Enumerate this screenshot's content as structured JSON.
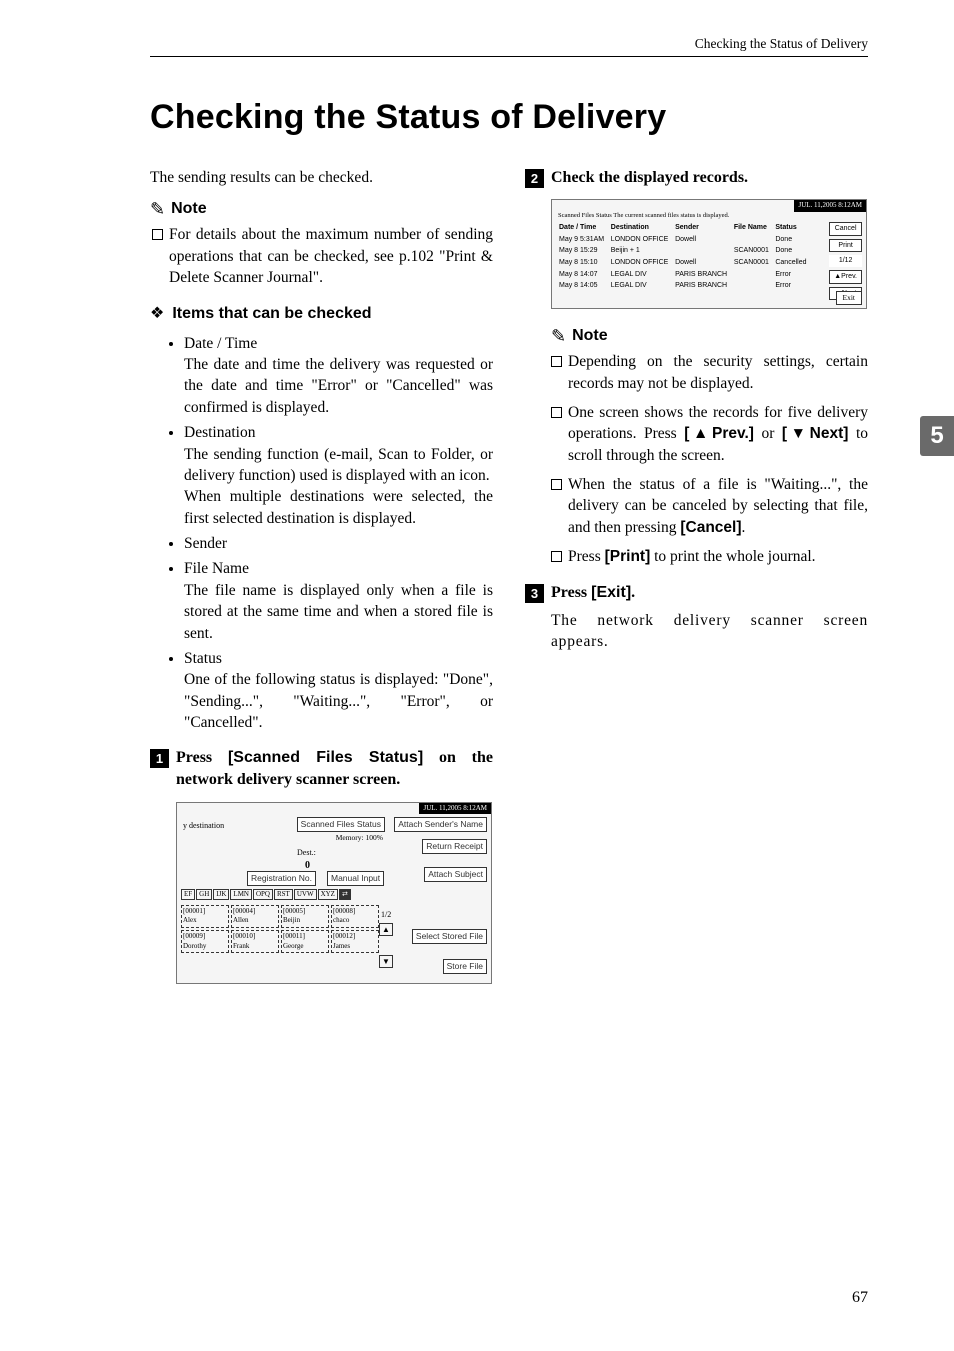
{
  "running_header": "Checking the Status of Delivery",
  "title": "Checking the Status of Delivery",
  "intro": "The sending results can be checked.",
  "note_label": "Note",
  "top_note": "For details about the maximum number of sending operations that can be checked, see p.102 \"Print & Delete Scanner Journal\".",
  "items_heading": "Items that can be checked",
  "items": [
    {
      "title": "Date / Time",
      "body": "The date and time the delivery was requested or the date and time \"Error\" or \"Cancelled\" was confirmed is displayed."
    },
    {
      "title": "Destination",
      "body": "The sending function (e-mail, Scan to Folder, or delivery function) used is displayed with an icon.",
      "body2": "When multiple destinations were selected, the first selected destination is displayed."
    },
    {
      "title": "Sender",
      "body": ""
    },
    {
      "title": "File Name",
      "body": "The file name is displayed only when a file is stored at the same time and when a stored file is sent."
    },
    {
      "title": "Status",
      "body": "One of the following status is displayed: \"Done\", \"Sending...\", \"Waiting...\", \"Error\", or \"Cancelled\"."
    }
  ],
  "steps": {
    "s1": {
      "pre": "Press ",
      "btn1": "[Scanned Files Status]",
      "post": " on the network delivery scanner screen."
    },
    "s2": "Check the displayed records.",
    "s3": {
      "pre": "Press ",
      "btn": "[Exit]",
      "post": "."
    }
  },
  "right_notes": [
    "Depending on the security settings, certain records may not be displayed.",
    {
      "pre": "One screen shows the records for five delivery operations. Press ",
      "b1": "[▲Prev.]",
      "mid": " or ",
      "b2": "[▼Next]",
      "post": " to scroll through the screen."
    },
    {
      "pre": "When the status of a file is \"Waiting...\", the delivery can be canceled by selecting that file, and then pressing ",
      "b": "[Cancel]",
      "post": "."
    },
    {
      "pre": "Press ",
      "b": "[Print]",
      "post": " to print the whole journal."
    }
  ],
  "step3_follow": "The network delivery scanner screen appears.",
  "tab": "5",
  "page_number": "67",
  "screenshot1": {
    "topstrip": "JUL. 11,2005 8:12AM",
    "sfs": "Scanned Files Status",
    "attach_sender": "Attach Sender's Name",
    "memory": "Memory: 100%",
    "return_receipt": "Return Receipt",
    "dest": "Dest.:",
    "dest_count": "0",
    "reg": "Registration No.",
    "manual": "Manual Input",
    "attach_subject": "Attach Subject",
    "tabs": [
      "EF",
      "GH",
      "IJK",
      "LMN",
      "OPQ",
      "RST",
      "UVW",
      "XYZ"
    ],
    "grid": [
      [
        "[00001]",
        "[00004]",
        "[00005]",
        "[00008]"
      ],
      [
        "Alex",
        "Allen",
        "Beijin",
        "chaco"
      ],
      [
        "[00009]",
        "[00010]",
        "[00011]",
        "[00012]"
      ],
      [
        "Dorothy",
        "Frank",
        "George",
        "James"
      ]
    ],
    "page": "1/2",
    "select_stored": "Select Stored File",
    "store_file": "Store File"
  },
  "screenshot2": {
    "topstrip": "JUL. 11,2005 8:12AM",
    "caption": "Scanned Files Status      The current scanned files status is displayed.",
    "headers": [
      "Date / Time",
      "Destination",
      "Sender",
      "File Name",
      "Status"
    ],
    "rows": [
      [
        "May 9 5:31AM",
        "LONDON OFFICE",
        "Dowell",
        "",
        "Done"
      ],
      [
        "May 8 15:29",
        "Beijin      + 1",
        "",
        "SCAN0001",
        "Done"
      ],
      [
        "May 8 15:10",
        "LONDON OFFICE",
        "Dowell",
        "SCAN0001",
        "Cancelled"
      ],
      [
        "May 8 14:07",
        "LEGAL DIV",
        "PARIS BRANCH",
        "",
        "Error"
      ],
      [
        "May 8 14:05",
        "LEGAL DIV",
        "PARIS BRANCH",
        "",
        "Error"
      ]
    ],
    "side": {
      "cancel": "Cancel",
      "print": "Print",
      "page": "1/12",
      "prev": "▲Prev.",
      "next": "▼Next",
      "exit": "Exit"
    }
  }
}
